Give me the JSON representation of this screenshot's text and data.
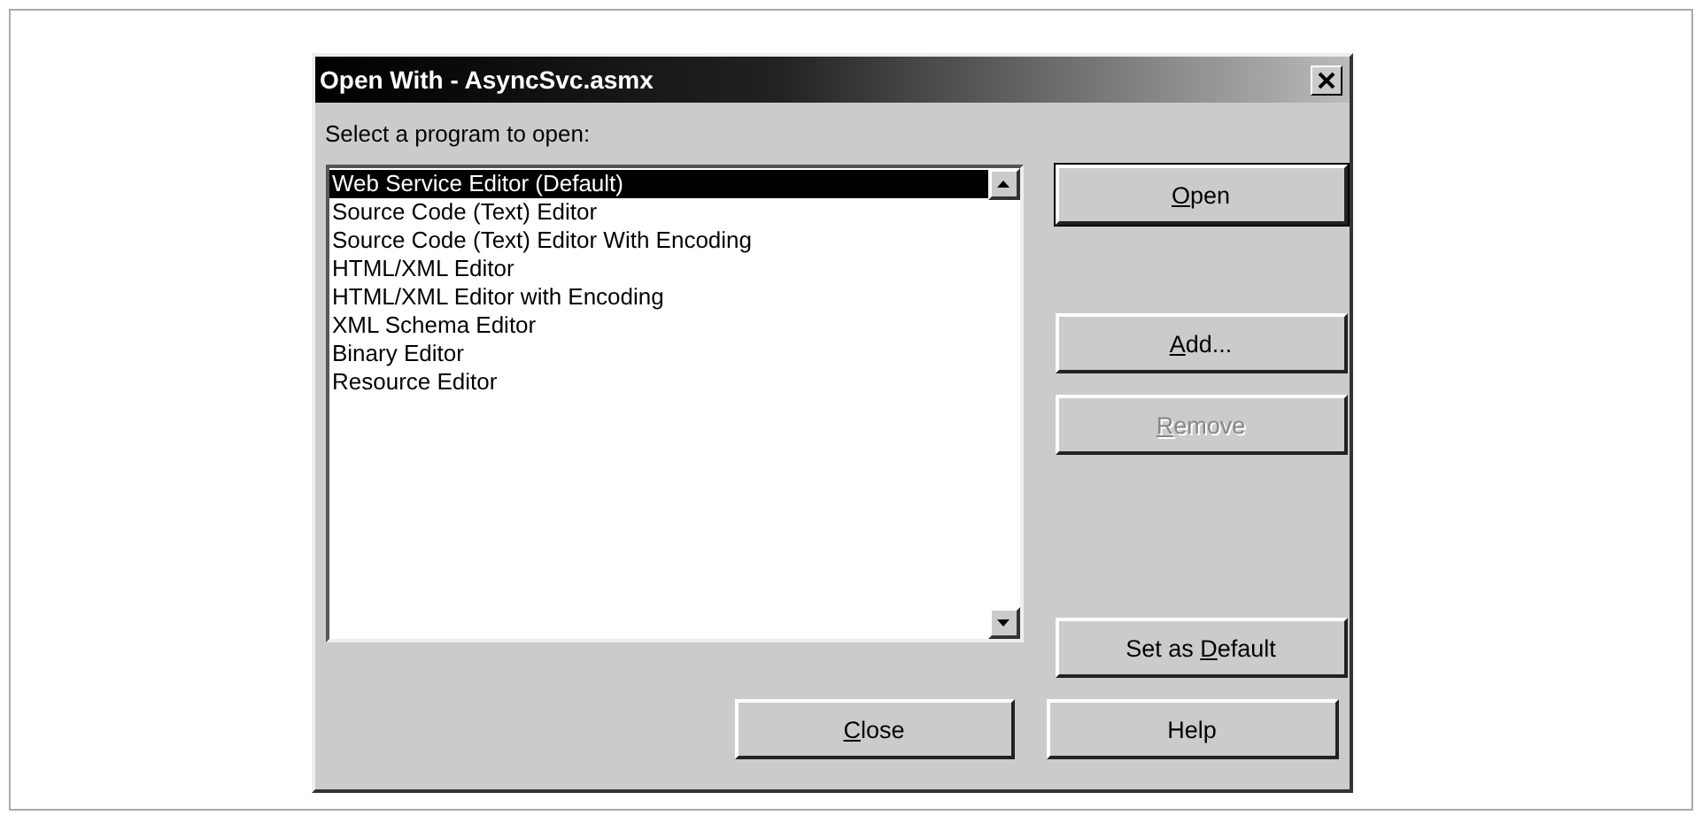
{
  "window": {
    "title": "Open With - AsyncSvc.asmx"
  },
  "prompt": "Select a program to open:",
  "programs": [
    {
      "label": "Web Service Editor (Default)",
      "selected": true
    },
    {
      "label": "Source Code (Text) Editor",
      "selected": false
    },
    {
      "label": "Source Code (Text) Editor With Encoding",
      "selected": false
    },
    {
      "label": "HTML/XML Editor",
      "selected": false
    },
    {
      "label": "HTML/XML Editor with Encoding",
      "selected": false
    },
    {
      "label": "XML Schema Editor",
      "selected": false
    },
    {
      "label": "Binary Editor",
      "selected": false
    },
    {
      "label": "Resource Editor",
      "selected": false
    }
  ],
  "side_buttons": [
    {
      "key": "O",
      "after": "pen",
      "disabled": false,
      "default": true
    },
    {
      "key": "A",
      "after": "dd...",
      "disabled": false,
      "default": false
    },
    {
      "key": "R",
      "after": "emove",
      "disabled": true,
      "default": false
    },
    {
      "before": "Set as ",
      "key": "D",
      "after": "efault",
      "disabled": false,
      "default": false
    }
  ],
  "bottom_buttons": [
    {
      "key": "C",
      "after": "lose",
      "disabled": false,
      "default": false
    },
    {
      "before": "Help",
      "disabled": false,
      "default": false
    }
  ]
}
